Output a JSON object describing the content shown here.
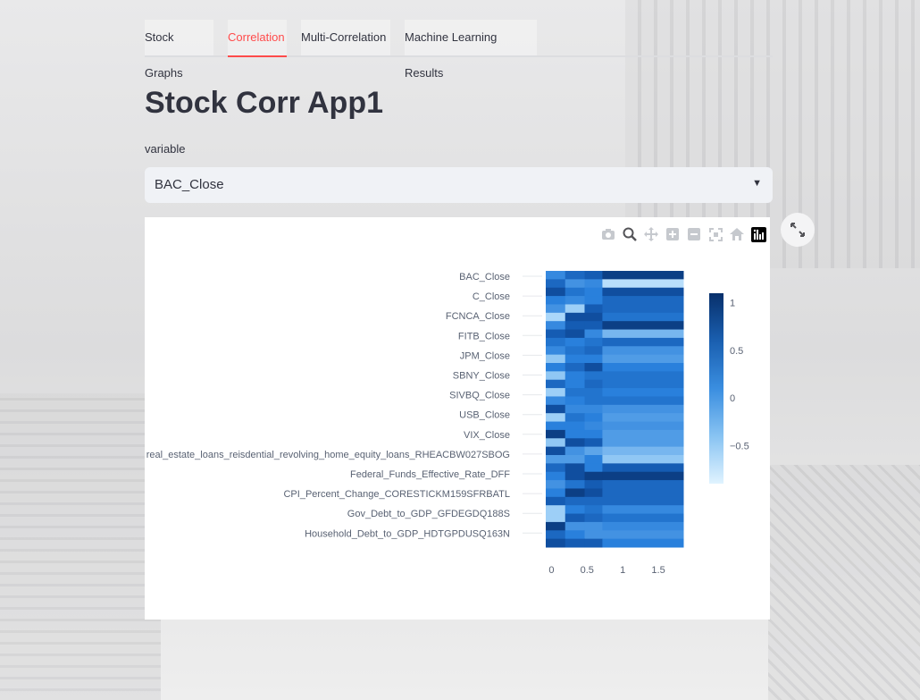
{
  "tabs": [
    {
      "label": "Stock Graphs",
      "active": false
    },
    {
      "label": "Correlation",
      "active": true
    },
    {
      "label": "Multi-Correlation",
      "active": false
    },
    {
      "label": "Machine Learning Results",
      "active": false
    }
  ],
  "page": {
    "title": "Stock Corr App1"
  },
  "select": {
    "label": "variable",
    "value": "BAC_Close"
  },
  "modebar": {
    "icons": [
      "camera-icon",
      "zoom-icon",
      "pan-icon",
      "zoom-in-icon",
      "zoom-out-icon",
      "autoscale-icon",
      "home-icon",
      "plotly-logo-icon"
    ]
  },
  "colors": {
    "accent": "#ff4b4b",
    "heat_low": "#e0f3ff",
    "heat_high": "#08306b"
  },
  "chart_data": {
    "type": "heatmap",
    "y_labels": [
      "BAC_Close",
      "C_Close",
      "FCNCA_Close",
      "FITB_Close",
      "JPM_Close",
      "SBNY_Close",
      "SIVBQ_Close",
      "USB_Close",
      "VIX_Close",
      "real_estate_loans_reisdential_revolving_home_equity_loans_RHEACBW027SBOG",
      "Federal_Funds_Effective_Rate_DFF",
      "CPI_Percent_Change_CORESTICKM159SFRBATL",
      "Gov_Debt_to_GDP_GFDEGDQ188S",
      "Household_Debt_to_GDP_HDTGPDUSQ163N"
    ],
    "x_ticks": [
      "0",
      "0.5",
      "1",
      "1.5"
    ],
    "x_range": [
      -0.08,
      1.85
    ],
    "colorbar": {
      "ticks": [
        "1",
        "0.5",
        "0",
        "−0.5"
      ],
      "range": [
        -0.9,
        1.1
      ]
    },
    "column_widths": [
      0.24,
      0.24,
      0.22,
      1.0
    ],
    "values": [
      [
        0.4,
        0.7,
        0.8,
        1.0
      ],
      [
        0.7,
        0.3,
        0.4,
        -0.6
      ],
      [
        0.9,
        0.6,
        0.5,
        0.9
      ],
      [
        0.5,
        0.4,
        0.5,
        0.7
      ],
      [
        0.3,
        -0.4,
        0.8,
        0.7
      ],
      [
        -0.5,
        0.9,
        0.9,
        0.6
      ],
      [
        0.4,
        0.8,
        0.8,
        1.0
      ],
      [
        0.8,
        0.9,
        0.4,
        -0.1
      ],
      [
        0.6,
        0.5,
        0.6,
        0.7
      ],
      [
        0.4,
        0.6,
        0.7,
        0.3
      ],
      [
        -0.3,
        0.5,
        0.5,
        0.2
      ],
      [
        0.5,
        0.7,
        0.9,
        0.5
      ],
      [
        -0.3,
        0.5,
        0.6,
        0.6
      ],
      [
        0.7,
        0.5,
        0.7,
        0.6
      ],
      [
        -0.4,
        0.6,
        0.6,
        0.5
      ],
      [
        0.4,
        0.5,
        0.6,
        0.6
      ],
      [
        0.9,
        0.4,
        0.4,
        0.3
      ],
      [
        -0.4,
        0.6,
        0.5,
        0.2
      ],
      [
        0.5,
        0.5,
        0.4,
        0.3
      ],
      [
        1.0,
        0.5,
        0.5,
        0.2
      ],
      [
        -0.3,
        0.9,
        0.8,
        0.2
      ],
      [
        0.9,
        0.3,
        0.1,
        -0.1
      ],
      [
        0.2,
        0.2,
        0.5,
        -0.3
      ],
      [
        0.7,
        0.9,
        0.5,
        0.8
      ],
      [
        0.5,
        0.9,
        1.0,
        1.0
      ],
      [
        0.3,
        0.6,
        0.8,
        0.7
      ],
      [
        0.5,
        1.0,
        0.9,
        0.7
      ],
      [
        0.8,
        0.7,
        0.7,
        0.7
      ],
      [
        -0.4,
        0.5,
        0.6,
        0.4
      ],
      [
        -0.4,
        0.8,
        0.7,
        0.6
      ],
      [
        1.0,
        0.3,
        0.3,
        0.4
      ],
      [
        0.7,
        0.5,
        0.3,
        0.3
      ],
      [
        0.9,
        0.8,
        0.8,
        0.5
      ]
    ]
  }
}
